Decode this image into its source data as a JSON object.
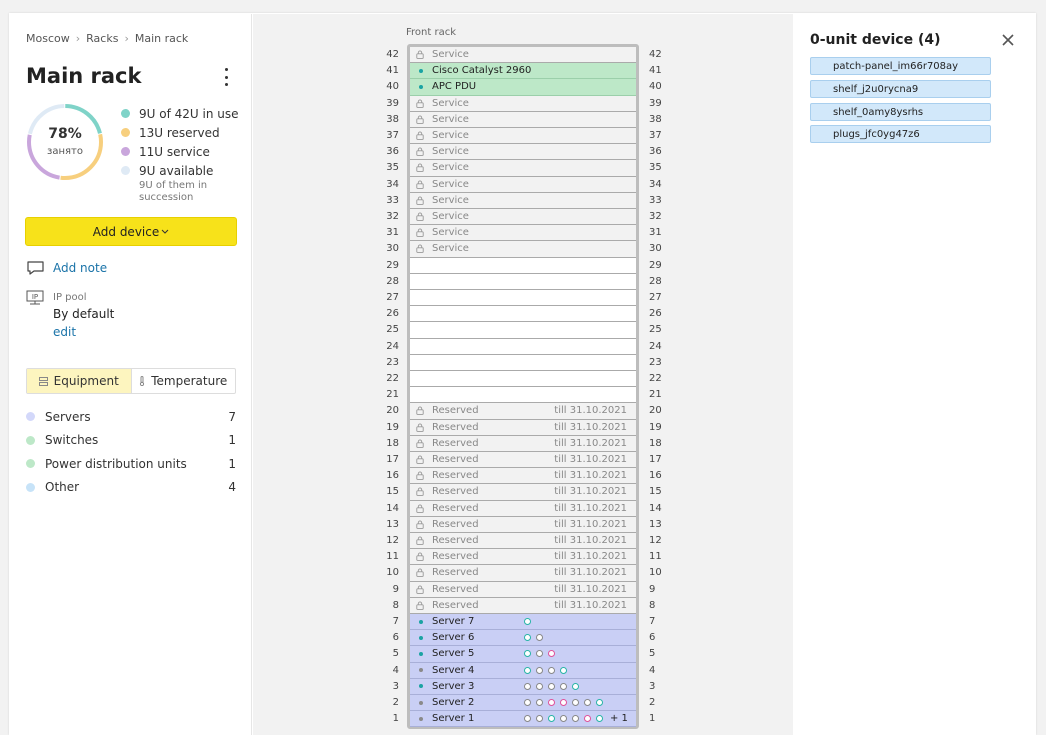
{
  "breadcrumb": [
    "Moscow",
    "Racks",
    "Main rack"
  ],
  "title": "Main rack",
  "usage": {
    "percent_label": "78%",
    "sub_label": "занято",
    "segments": [
      {
        "units": 9,
        "color": "#7fd3c8"
      },
      {
        "units": 13,
        "color": "#f7cf7e"
      },
      {
        "units": 11,
        "color": "#c9a6dc"
      },
      {
        "units": 9,
        "color": "#dfeaf5"
      }
    ],
    "legend": [
      {
        "label": "9U of 42U in use",
        "color": "#7fd3c8"
      },
      {
        "label": "13U reserved",
        "color": "#f7cf7e"
      },
      {
        "label": "11U service",
        "color": "#c9a6dc"
      },
      {
        "label": "9U available",
        "color": "#dfeaf5"
      }
    ],
    "available_note": "9U of them in succession"
  },
  "add_device_label": "Add device",
  "add_note_label": "Add note",
  "ip_pool": {
    "icon_text": "IP",
    "label": "IP pool",
    "value": "By default",
    "edit_label": "edit"
  },
  "tabs": [
    {
      "label": "Equipment",
      "icon": "equipment-icon",
      "active": true
    },
    {
      "label": "Temperature",
      "icon": "thermometer-icon",
      "active": false
    }
  ],
  "categories": [
    {
      "label": "Servers",
      "count": "7",
      "color": "#d3d8fa"
    },
    {
      "label": "Switches",
      "count": "1",
      "color": "#bde8c8"
    },
    {
      "label": "Power distribution units",
      "count": "1",
      "color": "#bde8c8"
    },
    {
      "label": "Other",
      "count": "4",
      "color": "#c7e3f8"
    }
  ],
  "rack": {
    "title": "Front rack",
    "total_units": 42,
    "units": [
      {
        "u": 42,
        "type": "service",
        "label": "Service"
      },
      {
        "u": 41,
        "type": "switch",
        "label": "Cisco Catalyst 2960"
      },
      {
        "u": 40,
        "type": "switch",
        "label": "APC PDU"
      },
      {
        "u": 39,
        "type": "service",
        "label": "Service"
      },
      {
        "u": 38,
        "type": "service",
        "label": "Service"
      },
      {
        "u": 37,
        "type": "service",
        "label": "Service"
      },
      {
        "u": 36,
        "type": "service",
        "label": "Service"
      },
      {
        "u": 35,
        "type": "service",
        "label": "Service"
      },
      {
        "u": 34,
        "type": "service",
        "label": "Service"
      },
      {
        "u": 33,
        "type": "service",
        "label": "Service"
      },
      {
        "u": 32,
        "type": "service",
        "label": "Service"
      },
      {
        "u": 31,
        "type": "service",
        "label": "Service"
      },
      {
        "u": 30,
        "type": "service",
        "label": "Service"
      },
      {
        "u": 29,
        "type": "empty"
      },
      {
        "u": 28,
        "type": "empty"
      },
      {
        "u": 27,
        "type": "empty"
      },
      {
        "u": 26,
        "type": "empty"
      },
      {
        "u": 25,
        "type": "empty"
      },
      {
        "u": 24,
        "type": "empty"
      },
      {
        "u": 23,
        "type": "empty"
      },
      {
        "u": 22,
        "type": "empty"
      },
      {
        "u": 21,
        "type": "empty"
      },
      {
        "u": 20,
        "type": "reserved",
        "label": "Reserved",
        "till": "till 31.10.2021"
      },
      {
        "u": 19,
        "type": "reserved",
        "label": "Reserved",
        "till": "till 31.10.2021"
      },
      {
        "u": 18,
        "type": "reserved",
        "label": "Reserved",
        "till": "till 31.10.2021"
      },
      {
        "u": 17,
        "type": "reserved",
        "label": "Reserved",
        "till": "till 31.10.2021"
      },
      {
        "u": 16,
        "type": "reserved",
        "label": "Reserved",
        "till": "till 31.10.2021"
      },
      {
        "u": 15,
        "type": "reserved",
        "label": "Reserved",
        "till": "till 31.10.2021"
      },
      {
        "u": 14,
        "type": "reserved",
        "label": "Reserved",
        "till": "till 31.10.2021"
      },
      {
        "u": 13,
        "type": "reserved",
        "label": "Reserved",
        "till": "till 31.10.2021"
      },
      {
        "u": 12,
        "type": "reserved",
        "label": "Reserved",
        "till": "till 31.10.2021"
      },
      {
        "u": 11,
        "type": "reserved",
        "label": "Reserved",
        "till": "till 31.10.2021"
      },
      {
        "u": 10,
        "type": "reserved",
        "label": "Reserved",
        "till": "till 31.10.2021"
      },
      {
        "u": 9,
        "type": "reserved",
        "label": "Reserved",
        "till": "till 31.10.2021"
      },
      {
        "u": 8,
        "type": "reserved",
        "label": "Reserved",
        "till": "till 31.10.2021"
      },
      {
        "u": 7,
        "type": "server",
        "label": "Server 7",
        "dot": "#1aa3a3",
        "ports": [
          "#27b5a6"
        ]
      },
      {
        "u": 6,
        "type": "server",
        "label": "Server 6",
        "dot": "#1aa3a3",
        "ports": [
          "#27b5a6",
          "#888888"
        ]
      },
      {
        "u": 5,
        "type": "server",
        "label": "Server 5",
        "dot": "#1aa3a3",
        "ports": [
          "#27b5a6",
          "#888888",
          "#e0529a"
        ]
      },
      {
        "u": 4,
        "type": "server",
        "label": "Server 4",
        "dot": "#8a8a8a",
        "ports": [
          "#27b5a6",
          "#888888",
          "#888888",
          "#27b5a6"
        ]
      },
      {
        "u": 3,
        "type": "server",
        "label": "Server 3",
        "dot": "#1aa3a3",
        "ports": [
          "#888888",
          "#888888",
          "#888888",
          "#888888",
          "#27b5a6"
        ]
      },
      {
        "u": 2,
        "type": "server",
        "label": "Server 2",
        "dot": "#8a8a8a",
        "ports": [
          "#888888",
          "#888888",
          "#e0529a",
          "#e0529a",
          "#888888",
          "#888888",
          "#27b5a6"
        ]
      },
      {
        "u": 1,
        "type": "server",
        "label": "Server 1",
        "dot": "#8a8a8a",
        "ports": [
          "#888888",
          "#888888",
          "#27b5a6",
          "#888888",
          "#888888",
          "#e0529a",
          "#27b5a6"
        ],
        "more": "+ 1"
      }
    ]
  },
  "zero_unit": {
    "title": "0-unit device (4)",
    "devices": [
      "patch-panel_im66r708ay",
      "shelf_j2u0rycna9",
      "shelf_0amy8ysrhs",
      "plugs_jfc0yg47z6"
    ]
  }
}
